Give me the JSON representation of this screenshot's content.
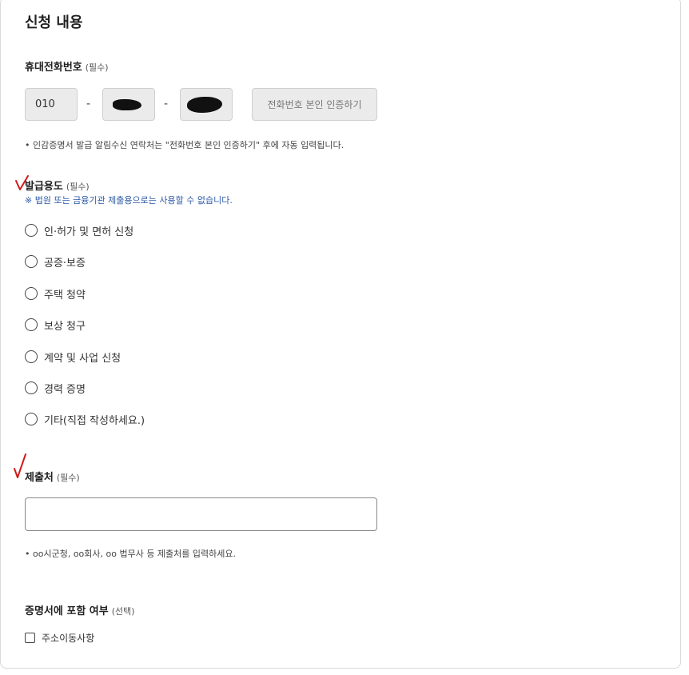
{
  "section": {
    "title": "신청 내용"
  },
  "phone": {
    "label": "휴대전화번호",
    "required": "(필수)",
    "prefix": "010",
    "separator": "-",
    "verify_button": "전화번호 본인 인증하기",
    "note": "인감증명서 발급 알림수신 연락처는 \"전화번호 본인 인증하기\" 후에 자동 입력됩니다."
  },
  "purpose": {
    "label": "발급용도",
    "required": "(필수)",
    "warning": "※ 법원 또는 금융기관 제출용으로는 사용할 수 없습니다.",
    "options": [
      "인·허가 및 면허 신청",
      "공증·보증",
      "주택 청약",
      "보상 청구",
      "계약 및 사업 신청",
      "경력 증명",
      "기타(직접 작성하세요.)"
    ]
  },
  "submit_to": {
    "label": "제출처",
    "required": "(필수)",
    "value": "",
    "note": "oo시군청, oo회사, oo 법무사 등 제출처를 입력하세요."
  },
  "include": {
    "label": "증명서에 포함 여부",
    "optional": "(선택)",
    "checkbox_label": "주소이동사항"
  },
  "colors": {
    "warning": "#2b58a6",
    "annotation": "#d11a1a",
    "disabled_bg": "#ebebeb"
  }
}
